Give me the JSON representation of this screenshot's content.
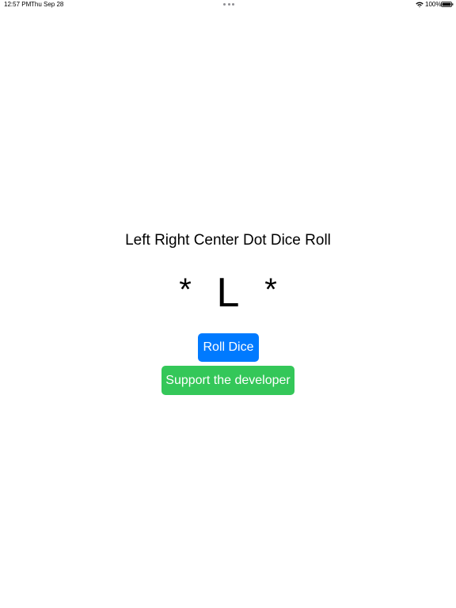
{
  "status_bar": {
    "time": "12:57 PM",
    "date": "Thu Sep 28",
    "battery_percent": "100%",
    "battery_level": 1.0,
    "icons": [
      "multitask-dots-icon",
      "wifi-icon",
      "battery-icon"
    ]
  },
  "app": {
    "title": "Left Right Center Dot Dice Roll",
    "dice": [
      "*",
      "L",
      "*"
    ]
  },
  "buttons": {
    "roll_label": "Roll Dice",
    "support_label": "Support the developer"
  },
  "colors": {
    "roll_button": "#007aff",
    "support_button": "#34c759",
    "background": "#ffffff",
    "text": "#000000"
  }
}
